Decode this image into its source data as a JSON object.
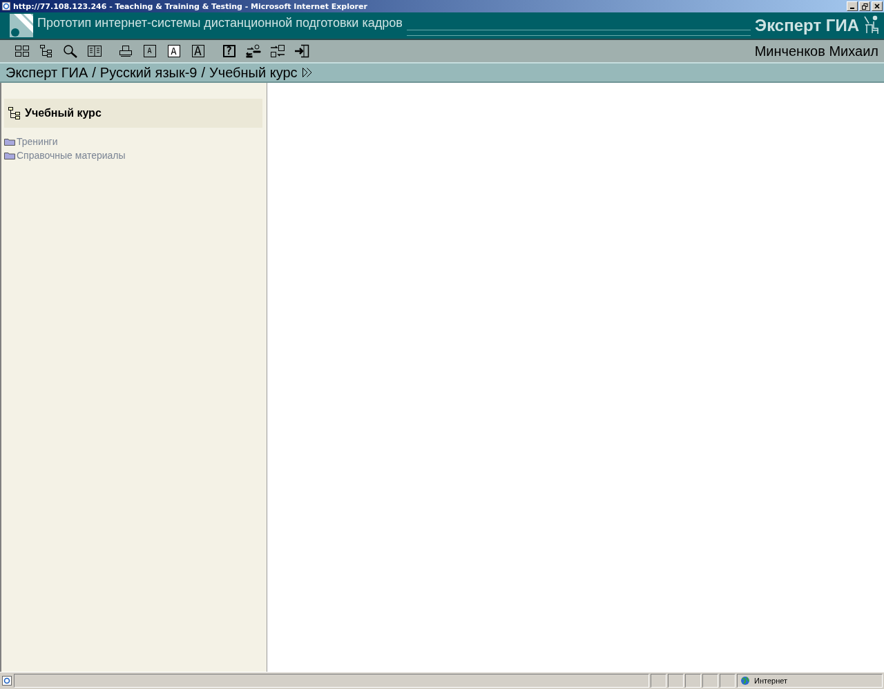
{
  "window": {
    "title": "http://77.108.123.246 - Teaching & Training & Testing - Microsoft Internet Explorer"
  },
  "header": {
    "subtitle": "Прототип интернет-системы дистанционной подготовки кадров",
    "brand": "Эксперт ГИА"
  },
  "toolbar": [
    {
      "kind": "grid"
    },
    {
      "kind": "tree"
    },
    {
      "kind": "search"
    },
    {
      "kind": "book"
    },
    {
      "kind": "print",
      "gap": true
    },
    {
      "kind": "font-small",
      "label": "A"
    },
    {
      "kind": "font-medium",
      "label": "A"
    },
    {
      "kind": "font-large",
      "label": "A"
    },
    {
      "kind": "help",
      "label": "?",
      "gap": true
    },
    {
      "kind": "users"
    },
    {
      "kind": "exchange"
    },
    {
      "kind": "exit"
    }
  ],
  "user": "Минченков Михаил",
  "breadcrumb": {
    "items": [
      "Эксперт ГИА",
      "Русский язык-9",
      "Учебный курс"
    ],
    "separators": [
      "/",
      "/"
    ]
  },
  "sidebar": {
    "title": "Учебный курс",
    "items": [
      {
        "label": "Тренинги"
      },
      {
        "label": "Справочные материалы"
      }
    ]
  },
  "status_bar": {
    "zone": "Интернет"
  }
}
